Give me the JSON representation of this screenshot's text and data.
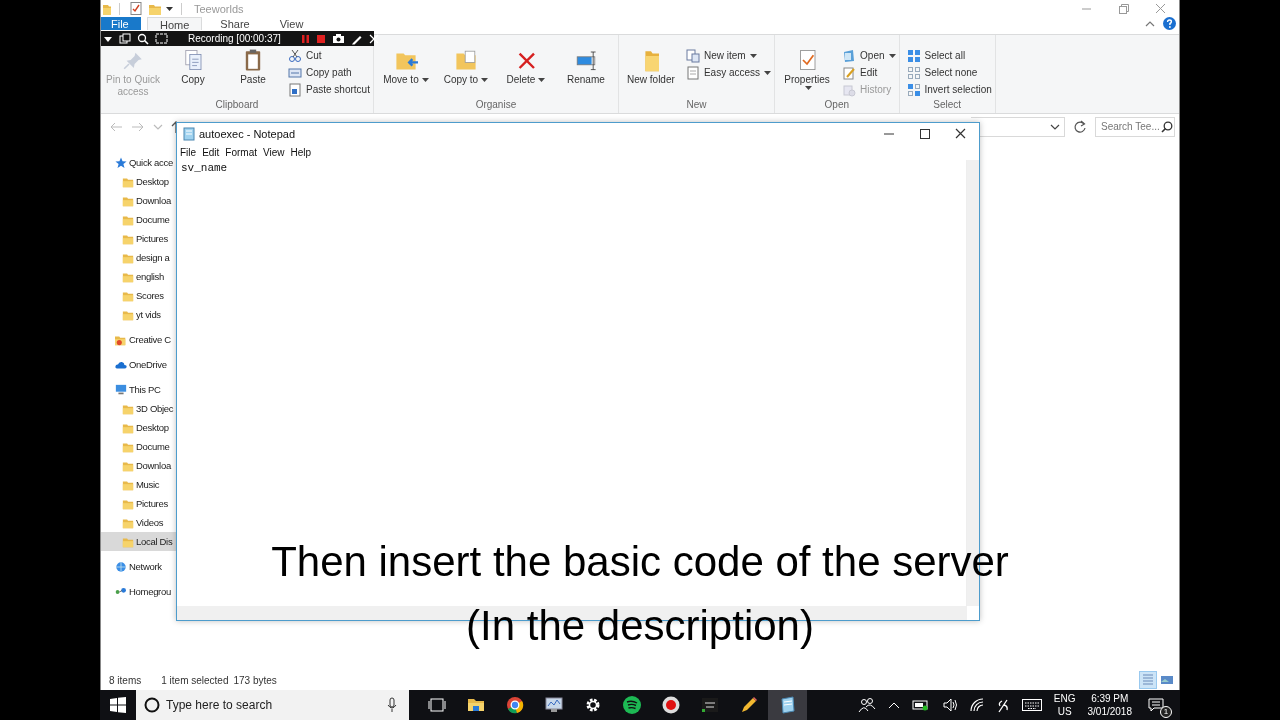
{
  "explorer": {
    "title": "Teeworlds",
    "tabs": [
      {
        "label": "File",
        "kind": "file",
        "selected": false
      },
      {
        "label": "Home",
        "kind": "tab",
        "selected": true
      },
      {
        "label": "Share",
        "kind": "tab",
        "selected": false
      },
      {
        "label": "View",
        "kind": "tab",
        "selected": false
      }
    ],
    "ribbon": {
      "groups": [
        {
          "label": "Clipboard",
          "commands": [
            {
              "label": "Pin to Quick access",
              "kind": "large",
              "disabled": true,
              "dropdown": false
            },
            {
              "label": "Copy",
              "kind": "large",
              "disabled": false,
              "dropdown": false
            },
            {
              "label": "Paste",
              "kind": "large",
              "disabled": false,
              "dropdown": false
            },
            {
              "label": "Cut",
              "kind": "small",
              "disabled": false,
              "dropdown": false
            },
            {
              "label": "Copy path",
              "kind": "small",
              "disabled": false,
              "dropdown": false
            },
            {
              "label": "Paste shortcut",
              "kind": "small",
              "disabled": false,
              "dropdown": false
            }
          ]
        },
        {
          "label": "Organise",
          "commands": [
            {
              "label": "Move to",
              "kind": "large",
              "disabled": false,
              "dropdown": true
            },
            {
              "label": "Copy to",
              "kind": "large",
              "disabled": false,
              "dropdown": true
            },
            {
              "label": "Delete",
              "kind": "large",
              "disabled": false,
              "dropdown": true
            },
            {
              "label": "Rename",
              "kind": "large",
              "disabled": false,
              "dropdown": false
            }
          ]
        },
        {
          "label": "New",
          "commands": [
            {
              "label": "New folder",
              "kind": "large",
              "disabled": false,
              "dropdown": false
            },
            {
              "label": "New item",
              "kind": "small",
              "disabled": false,
              "dropdown": true
            },
            {
              "label": "Easy access",
              "kind": "small",
              "disabled": false,
              "dropdown": true
            }
          ]
        },
        {
          "label": "Open",
          "commands": [
            {
              "label": "Properties",
              "kind": "large",
              "disabled": false,
              "dropdown": true
            },
            {
              "label": "Open",
              "kind": "small",
              "disabled": false,
              "dropdown": true
            },
            {
              "label": "Edit",
              "kind": "small",
              "disabled": false,
              "dropdown": false
            },
            {
              "label": "History",
              "kind": "small",
              "disabled": true,
              "dropdown": false
            }
          ]
        },
        {
          "label": "Select",
          "commands": [
            {
              "label": "Select all",
              "kind": "small",
              "disabled": false,
              "dropdown": false
            },
            {
              "label": "Select none",
              "kind": "small",
              "disabled": false,
              "dropdown": false
            },
            {
              "label": "Invert selection",
              "kind": "small",
              "disabled": false,
              "dropdown": false
            }
          ]
        }
      ]
    },
    "search": {
      "placeholder": "Search Tee..."
    },
    "nav_pane": {
      "items": [
        {
          "label": "Quick acce",
          "selected": false,
          "children": [
            {
              "label": "Desktop",
              "selected": false
            },
            {
              "label": "Downloa",
              "selected": false
            },
            {
              "label": "Docume",
              "selected": false
            },
            {
              "label": "Pictures",
              "selected": false
            },
            {
              "label": "design a",
              "selected": false
            },
            {
              "label": "english",
              "selected": false
            },
            {
              "label": "Scores",
              "selected": false
            },
            {
              "label": "yt vids",
              "selected": false
            }
          ]
        },
        {
          "label": "Creative C",
          "selected": false
        },
        {
          "label": "OneDrive",
          "selected": false
        },
        {
          "label": "This PC",
          "selected": false,
          "children": [
            {
              "label": "3D Objec",
              "selected": false
            },
            {
              "label": "Desktop",
              "selected": false
            },
            {
              "label": "Docume",
              "selected": false
            },
            {
              "label": "Downloa",
              "selected": false
            },
            {
              "label": "Music",
              "selected": false
            },
            {
              "label": "Pictures",
              "selected": false
            },
            {
              "label": "Videos",
              "selected": false
            },
            {
              "label": "Local Dis",
              "selected": true
            }
          ]
        },
        {
          "label": "Network",
          "selected": false
        },
        {
          "label": "Homegrou",
          "selected": false
        }
      ]
    },
    "status_bar": {
      "item_count": "8 items",
      "selection": "1 item selected",
      "size": "173 bytes",
      "views": [
        {
          "selected": true
        },
        {
          "selected": false
        }
      ]
    }
  },
  "notepad": {
    "title": "autoexec - Notepad",
    "menu": [
      "File",
      "Edit",
      "Format",
      "View",
      "Help"
    ],
    "text": "sv_name"
  },
  "recorder": {
    "status": "Recording [00:00:37]"
  },
  "caption": {
    "lines": [
      "Then insert the basic code of the server",
      "(In the description)"
    ]
  },
  "taskbar": {
    "search": {
      "placeholder": "Type here to search"
    },
    "apps": [
      {
        "active": false
      },
      {
        "active": false
      },
      {
        "active": false
      },
      {
        "active": false
      },
      {
        "active": false
      },
      {
        "active": false
      },
      {
        "active": false
      },
      {
        "active": false
      },
      {
        "active": false
      },
      {
        "active": true
      }
    ],
    "language": [
      "ENG",
      "US"
    ],
    "time": "6:39 PM",
    "date": "3/01/2018",
    "notifications": "1"
  }
}
